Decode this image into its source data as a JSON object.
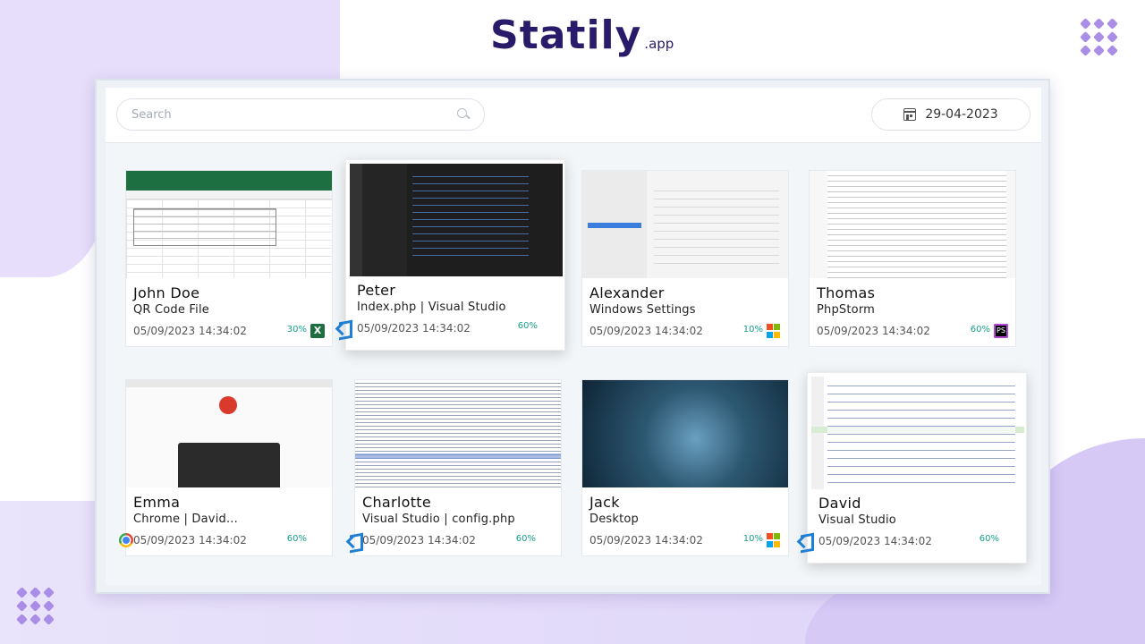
{
  "brand": {
    "name": "Statily",
    "suffix": ".app"
  },
  "search": {
    "placeholder": "Search"
  },
  "date": {
    "value": "29-04-2023"
  },
  "colors": {
    "accent": "#16a088",
    "brand": "#2a1a6a",
    "background_blob": "#e6defa"
  },
  "cards": [
    {
      "name": "John Doe",
      "app": "QR Code File",
      "time": "05/09/2023 14:34:02",
      "pct": "30%",
      "icon": "excel-icon"
    },
    {
      "name": "Peter",
      "app": "Index.php | Visual Studio",
      "time": "05/09/2023 14:34:02",
      "pct": "60%",
      "icon": "vscode-icon"
    },
    {
      "name": "Alexander",
      "app": "Windows Settings",
      "time": "05/09/2023 14:34:02",
      "pct": "10%",
      "icon": "windows-icon"
    },
    {
      "name": "Thomas",
      "app": "PhpStorm",
      "time": "05/09/2023 14:34:02",
      "pct": "60%",
      "icon": "phpstorm-icon"
    },
    {
      "name": "Emma",
      "app": "Chrome | David...",
      "time": "05/09/2023 14:34:02",
      "pct": "60%",
      "icon": "chrome-icon"
    },
    {
      "name": "Charlotte",
      "app": "Visual Studio | config.php",
      "time": "05/09/2023 14:34:02",
      "pct": "60%",
      "icon": "vscode-icon"
    },
    {
      "name": "Jack",
      "app": "Desktop",
      "time": "05/09/2023 14:34:02",
      "pct": "10%",
      "icon": "windows-icon"
    },
    {
      "name": "David",
      "app": "Visual Studio",
      "time": "05/09/2023 14:34:02",
      "pct": "60%",
      "icon": "vscode-icon"
    }
  ]
}
